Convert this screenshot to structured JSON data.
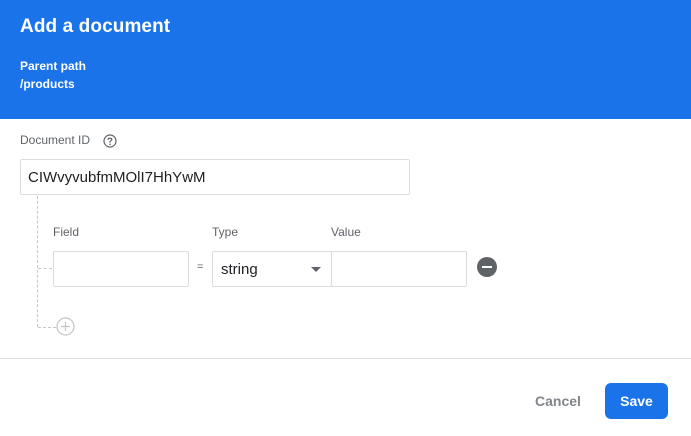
{
  "dialog": {
    "title": "Add a document",
    "parent_path_label": "Parent path",
    "parent_path": "/products"
  },
  "document_id": {
    "label": "Document ID",
    "value": "CIWvyvubfmMOlI7HhYwM",
    "help_icon": "help-circle-icon"
  },
  "fields": {
    "field_label": "Field",
    "type_label": "Type",
    "value_label": "Value",
    "equals_sign": "=",
    "rows": [
      {
        "field": "",
        "type": "string",
        "value": ""
      }
    ],
    "remove_icon": "remove-circle-icon",
    "add_icon": "add-circle-icon"
  },
  "actions": {
    "cancel_label": "Cancel",
    "save_label": "Save"
  },
  "colors": {
    "header_bg": "#1a73e8",
    "primary": "#1a73e8"
  }
}
